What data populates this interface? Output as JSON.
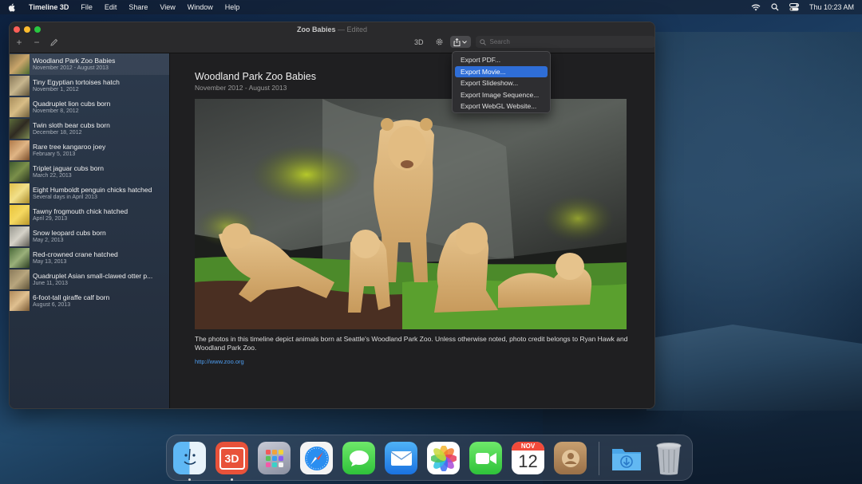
{
  "menubar": {
    "app_name": "Timeline 3D",
    "items": [
      "File",
      "Edit",
      "Share",
      "View",
      "Window",
      "Help"
    ],
    "clock": "Thu 10:23 AM"
  },
  "window": {
    "title": "Zoo Babies",
    "title_separator": "—",
    "edited_label": "Edited"
  },
  "toolbar": {
    "add_label": "+",
    "remove_label": "−",
    "three_d_label": "3D",
    "search_placeholder": "Search"
  },
  "export_menu": {
    "items": [
      "Export PDF...",
      "Export Movie...",
      "Export Slideshow...",
      "Export Image Sequence...",
      "Export WebGL Website..."
    ],
    "highlighted_index": 1
  },
  "sidebar": {
    "items": [
      {
        "title": "Woodland Park Zoo Babies",
        "date": "November 2012 - August 2013"
      },
      {
        "title": "Tiny Egyptian tortoises hatch",
        "date": "November 1, 2012"
      },
      {
        "title": "Quadruplet lion cubs born",
        "date": "November 8, 2012"
      },
      {
        "title": "Twin sloth bear cubs born",
        "date": "December 18, 2012"
      },
      {
        "title": "Rare tree kangaroo joey",
        "date": "February 5, 2013"
      },
      {
        "title": "Triplet jaguar cubs born",
        "date": "March 22, 2013"
      },
      {
        "title": "Eight Humboldt penguin chicks hatched",
        "date": "Several days in April 2013"
      },
      {
        "title": "Tawny frogmouth chick hatched",
        "date": "April 29, 2013"
      },
      {
        "title": "Snow leopard cubs born",
        "date": "May 2, 2013"
      },
      {
        "title": "Red-crowned crane hatched",
        "date": "May 13, 2013"
      },
      {
        "title": "Quadruplet Asian small-clawed otter p...",
        "date": "June 11, 2013"
      },
      {
        "title": "6-foot-tall giraffe calf born",
        "date": "August 6, 2013"
      }
    ]
  },
  "document": {
    "title": "Woodland Park Zoo Babies",
    "subtitle": "November 2012 - August 2013",
    "description": "The photos in this timeline depict animals born at Seattle's Woodland Park Zoo. Unless otherwise noted, photo credit belongs to Ryan Hawk and Woodland Park Zoo.",
    "link": "http://www.zoo.org"
  },
  "dock": {
    "apps": [
      "finder-icon",
      "timeline-3d-icon",
      "launchpad-icon",
      "safari-icon",
      "messages-icon",
      "mail-icon",
      "photos-icon",
      "facetime-icon",
      "calendar-icon",
      "contacts-icon",
      "downloads-folder-icon",
      "trash-icon"
    ],
    "timeline_label": "3D",
    "calendar_month": "NOV",
    "calendar_day": "12"
  },
  "colors": {
    "accent": "#2f6ed7",
    "link": "#4e9df0",
    "window_bg": "#1f1f21"
  }
}
